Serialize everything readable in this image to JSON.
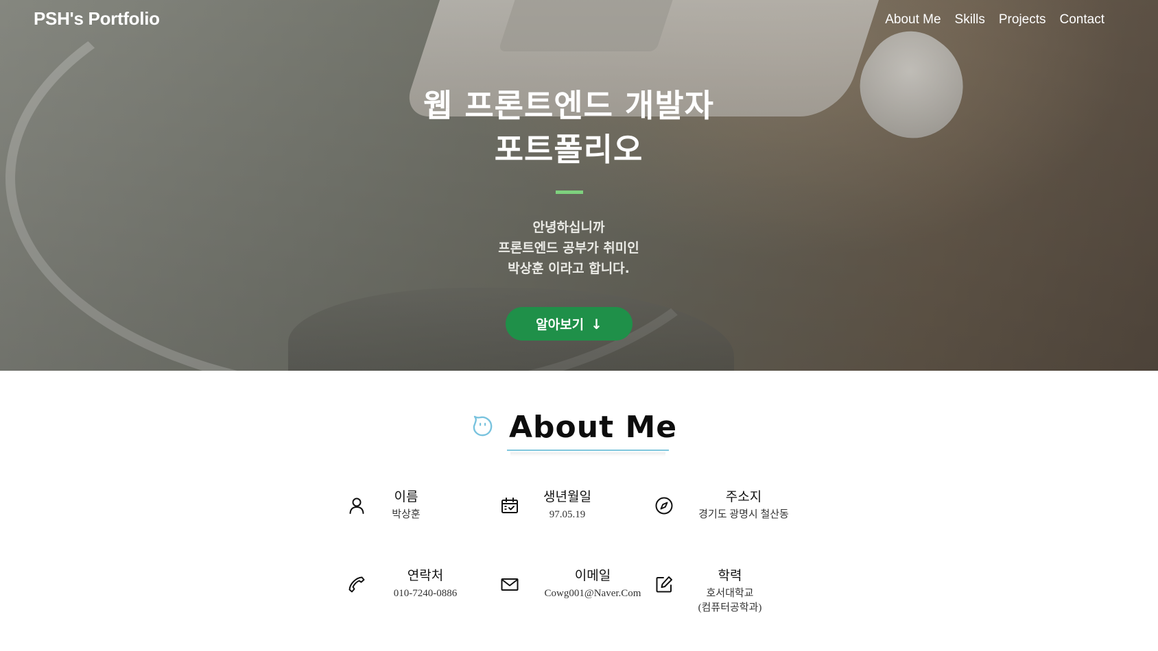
{
  "header": {
    "brand": "PSH's Portfolio",
    "nav": [
      "About Me",
      "Skills",
      "Projects",
      "Contact"
    ]
  },
  "hero": {
    "title_lines": [
      "웹 프론트엔드 개발자",
      "포트폴리오"
    ],
    "intro_lines": [
      "안녕하십니까",
      "프론트엔드 공부가 취미인",
      "박상훈 이라고 합니다."
    ],
    "cta_label": "알아보기",
    "cta_arrow": "↓",
    "divider_color": "#7ed17e",
    "cta_color": "#1f9049"
  },
  "about": {
    "title": "About Me",
    "accent_color": "#7fc6dd",
    "items": [
      {
        "icon": "person-icon",
        "label": "이름",
        "value": [
          "박상훈"
        ]
      },
      {
        "icon": "calendar-check-icon",
        "label": "생년월일",
        "value": [
          "97.05.19"
        ]
      },
      {
        "icon": "compass-icon",
        "label": "주소지",
        "value": [
          "경기도 광명시 철산동"
        ]
      },
      {
        "icon": "phone-icon",
        "label": "연락처",
        "value": [
          "010-7240-0886"
        ]
      },
      {
        "icon": "mail-icon",
        "label": "이메일",
        "value": [
          "Cowg001@Naver.Com"
        ]
      },
      {
        "icon": "edit-icon",
        "label": "학력",
        "value": [
          "호서대학교",
          "(컴퓨터공학과)"
        ]
      }
    ]
  }
}
